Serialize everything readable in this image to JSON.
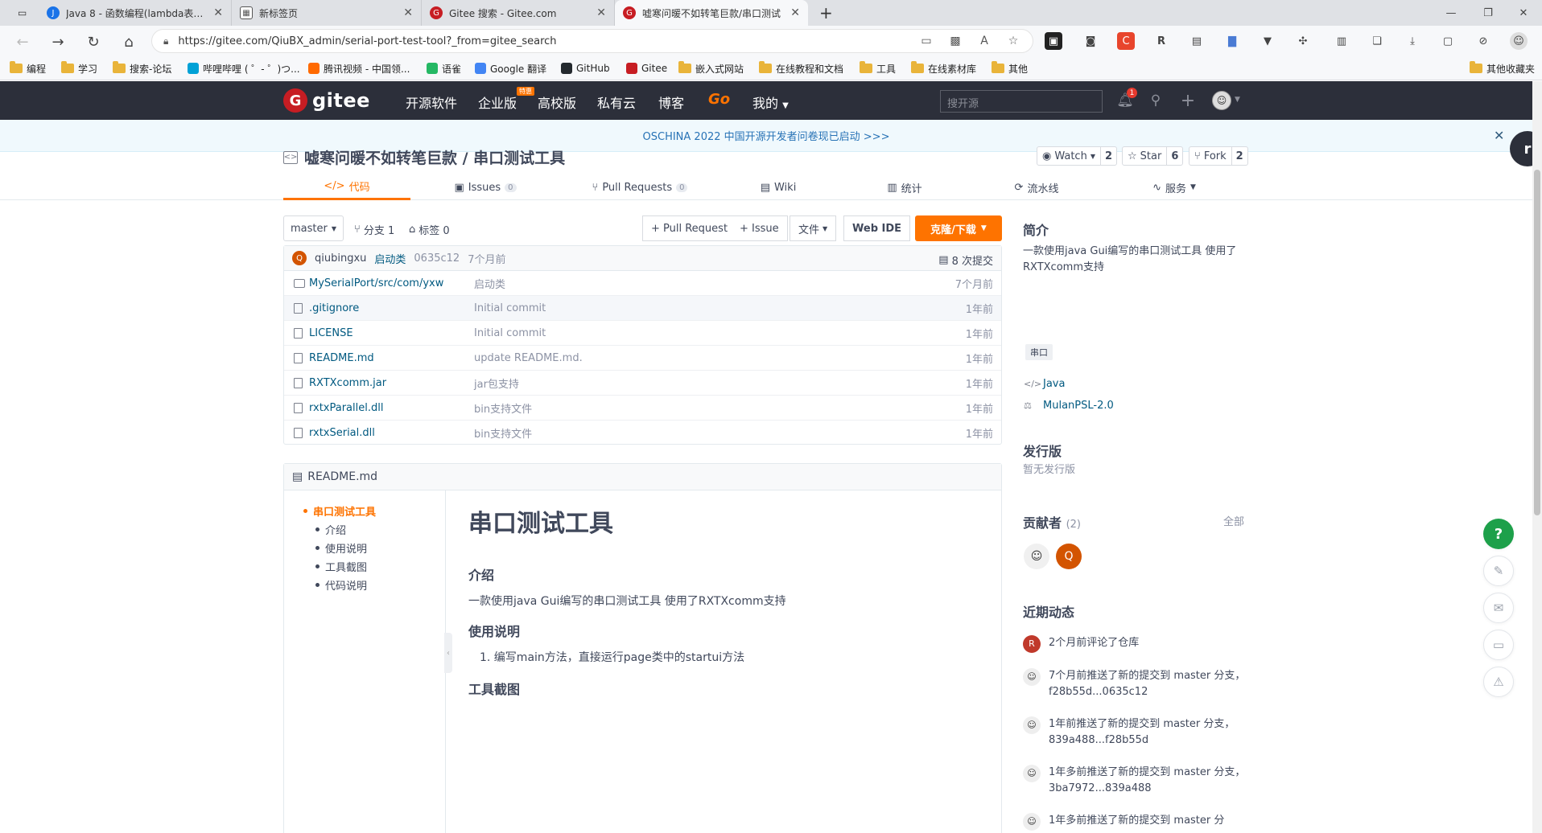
{
  "browser": {
    "tabs": [
      {
        "title": "Java 8 - 函数编程(lambda表达式",
        "color": "#1a73e8",
        "icon": "page-icon"
      },
      {
        "title": "新标签页",
        "color": "#555555",
        "icon": "newtab-icon"
      },
      {
        "title": "Gitee 搜索 - Gitee.com",
        "color": "#c71d23",
        "icon": "gitee-icon"
      },
      {
        "title": "嘘寒问暖不如转笔巨款/串口测试",
        "color": "#c71d23",
        "icon": "gitee-icon"
      }
    ],
    "new_tab": "+",
    "url": "https://gitee.com/QiuBX_admin/serial-port-test-tool?_from=gitee_search",
    "bookmarks": [
      {
        "label": "编程",
        "type": "folder"
      },
      {
        "label": "学习",
        "type": "folder"
      },
      {
        "label": "搜索-论坛",
        "type": "folder"
      },
      {
        "label": "哔哩哔哩 ( ゜- ゜)つ...",
        "type": "site",
        "color": "#00a1d6"
      },
      {
        "label": "腾讯视频 - 中国领...",
        "type": "site",
        "color": "#ff6a00"
      },
      {
        "label": "语雀",
        "type": "site",
        "color": "#25b864"
      },
      {
        "label": "Google 翻译",
        "type": "site",
        "color": "#4285f4"
      },
      {
        "label": "GitHub",
        "type": "site",
        "color": "#24292e"
      },
      {
        "label": "Gitee",
        "type": "site",
        "color": "#c71d23"
      },
      {
        "label": "嵌入式网站",
        "type": "folder"
      },
      {
        "label": "在线教程和文档",
        "type": "folder"
      },
      {
        "label": "工具",
        "type": "folder"
      },
      {
        "label": "在线素材库",
        "type": "folder"
      },
      {
        "label": "其他",
        "type": "folder"
      }
    ],
    "other_bookmarks": "其他收藏夹"
  },
  "gitee": {
    "logo": "gitee",
    "nav": [
      "开源软件",
      "企业版",
      "高校版",
      "私有云",
      "博客",
      "Go",
      "我的"
    ],
    "new_badge": "特惠",
    "search_placeholder": "搜开源",
    "notif_count": "1",
    "banner": "OSCHINA 2022 中国开源开发者问卷现已启动 >>>",
    "bubble": "r"
  },
  "repo": {
    "title": "嘘寒问暖不如转笔巨款 / 串口测试工具",
    "watch": {
      "label": "Watch",
      "count": "2"
    },
    "star": {
      "label": "Star",
      "count": "6"
    },
    "fork": {
      "label": "Fork",
      "count": "2"
    },
    "tabs": [
      {
        "label": "代码",
        "count": ""
      },
      {
        "label": "Issues",
        "count": "0"
      },
      {
        "label": "Pull Requests",
        "count": "0"
      },
      {
        "label": "Wiki",
        "count": ""
      },
      {
        "label": "统计",
        "count": ""
      },
      {
        "label": "流水线",
        "count": ""
      },
      {
        "label": "服务",
        "count": ""
      }
    ],
    "branch": "master",
    "branches": "分支 1",
    "tags": "标签 0",
    "pr_btn": "+ Pull Request",
    "issue_btn": "+ Issue",
    "file_btn": "文件",
    "webide_btn": "Web IDE",
    "clone_btn": "克隆/下载",
    "commit": {
      "avatar": "Q",
      "author": "qiubingxu",
      "message": "启动类",
      "hash": "0635c12",
      "time": "7个月前",
      "total": "8 次提交"
    },
    "files": [
      {
        "name": "MySerialPort/src/com/yxw",
        "msg": "启动类",
        "time": "7个月前",
        "dir": true
      },
      {
        "name": ".gitignore",
        "msg": "Initial commit",
        "time": "1年前",
        "dir": false
      },
      {
        "name": "LICENSE",
        "msg": "Initial commit",
        "time": "1年前",
        "dir": false
      },
      {
        "name": "README.md",
        "msg": "update README.md.",
        "time": "1年前",
        "dir": false
      },
      {
        "name": "RXTXcomm.jar",
        "msg": "jar包支持",
        "time": "1年前",
        "dir": false
      },
      {
        "name": "rxtxParallel.dll",
        "msg": "bin支持文件",
        "time": "1年前",
        "dir": false
      },
      {
        "name": "rxtxSerial.dll",
        "msg": "bin支持文件",
        "time": "1年前",
        "dir": false
      }
    ],
    "readme": {
      "filename": "README.md",
      "toc": [
        "串口测试工具",
        "介绍",
        "使用说明",
        "工具截图",
        "代码说明"
      ],
      "h1": "串口测试工具",
      "h_intro": "介绍",
      "p_intro": "一款使用java Gui编写的串口测试工具 使用了RXTXcomm支持",
      "h_usage": "使用说明",
      "p_usage": "1. 编写main方法，直接运行page类中的startui方法",
      "h_shot": "工具截图"
    }
  },
  "sidebar": {
    "intro_title": "简介",
    "intro_text": "一款使用java Gui编写的串口测试工具 使用了RXTXcomm支持",
    "tag": "串口",
    "language": "Java",
    "license": "MulanPSL-2.0",
    "release_title": "发行版",
    "release_text": "暂无发行版",
    "contrib_title": "贡献者",
    "contrib_count": "(2)",
    "contrib_all": "全部",
    "contrib_avatar2": "Q",
    "activity_title": "近期动态",
    "activities": [
      {
        "text": "2个月前评论了仓库",
        "avatar": "R",
        "color": "#c0392b"
      },
      {
        "text": "7个月前推送了新的提交到 master 分支，f28b55d...0635c12",
        "avatar": "",
        "color": "#888888"
      },
      {
        "text": "1年前推送了新的提交到 master 分支，839a488...f28b55d",
        "avatar": "",
        "color": "#888888"
      },
      {
        "text": "1年多前推送了新的提交到 master 分支，3ba7972...839a488",
        "avatar": "",
        "color": "#888888"
      },
      {
        "text": "1年多前推送了新的提交到 master 分",
        "avatar": "",
        "color": "#888888"
      }
    ]
  },
  "float": {
    "help": "?"
  }
}
